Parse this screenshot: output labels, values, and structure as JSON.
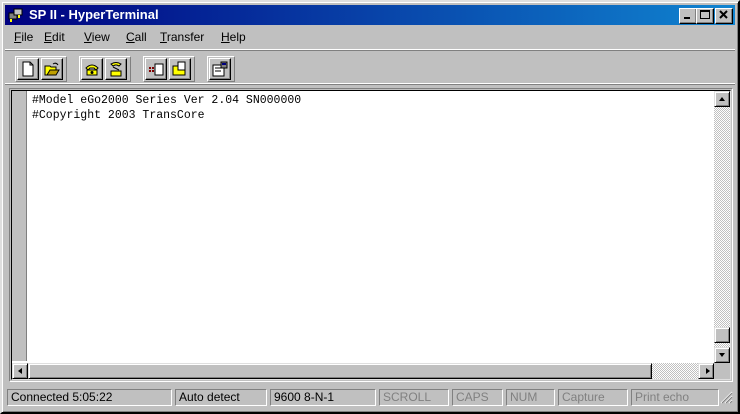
{
  "window": {
    "title": "SP II - HyperTerminal"
  },
  "menu": {
    "items": [
      {
        "label": "File",
        "key": "F",
        "rest": "ile"
      },
      {
        "label": "Edit",
        "key": "E",
        "rest": "dit"
      },
      {
        "label": "View",
        "key": "V",
        "rest": "iew"
      },
      {
        "label": "Call",
        "key": "C",
        "rest": "all"
      },
      {
        "label": "Transfer",
        "key": "T",
        "rest": "ransfer"
      },
      {
        "label": "Help",
        "key": "H",
        "rest": "elp"
      }
    ]
  },
  "toolbar": {
    "buttons": [
      "new-icon",
      "open-icon",
      "connect-phone-icon",
      "disconnect-phone-icon",
      "send-icon",
      "receive-icon",
      "properties-icon"
    ]
  },
  "terminal": {
    "lines": [
      "#Model eGo2000 Series Ver 2.04 SN000000",
      "#Copyright 2003 TransCore"
    ]
  },
  "status": {
    "connected": "Connected 5:05:22",
    "detect": "Auto detect",
    "settings": "9600 8-N-1",
    "scroll": "SCROLL",
    "caps": "CAPS",
    "num": "NUM",
    "capture": "Capture",
    "print_echo": "Print echo"
  }
}
